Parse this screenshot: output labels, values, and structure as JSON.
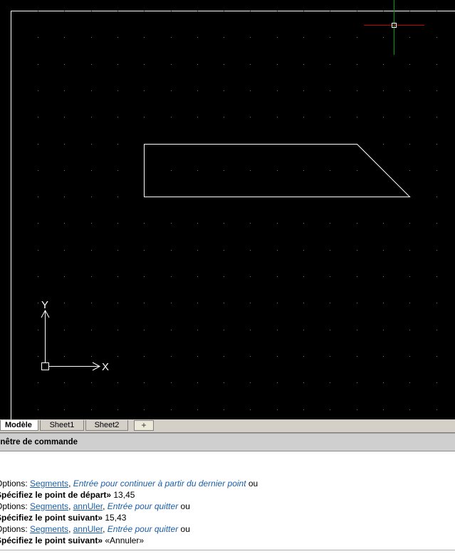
{
  "tabs": [
    {
      "label": "Modèle",
      "active": true
    },
    {
      "label": "Sheet1",
      "active": false
    },
    {
      "label": "Sheet2",
      "active": false
    }
  ],
  "add_tab_label": "+",
  "command_window": {
    "title": "enêtre de commande",
    "lines": [
      {
        "prefix": "Options: ",
        "opt1": "Segments",
        "sep1": ", ",
        "hint": "Entrée pour continuer à partir du dernier point",
        "suffix": " ou"
      },
      {
        "prompt": "Spécifiez le point de départ»",
        "value": " 13,45"
      },
      {
        "prefix": "Options: ",
        "opt1": "Segments",
        "sep1": ", ",
        "opt2a": "ann",
        "opt2b": "Ul",
        "opt2c": "er",
        "sep2": ", ",
        "hint": "Entrée pour quitter",
        "suffix": " ou"
      },
      {
        "prompt": "Spécifiez le point suivant»",
        "value": " 15,43"
      },
      {
        "prefix": "Options: ",
        "opt1": "Segments",
        "sep1": ", ",
        "opt2a": "ann",
        "opt2b": "Ul",
        "opt2c": "er",
        "sep2": ", ",
        "hint": "Entrée pour quitter",
        "suffix": " ou"
      },
      {
        "prompt": "Spécifiez le point suivant»",
        "value": " «Annuler»"
      }
    ]
  },
  "ucs": {
    "x_label": "X",
    "y_label": "Y"
  },
  "colors": {
    "canvas": "#000000",
    "crosshair_x": "#c00000",
    "crosshair_y": "#00a000",
    "option_link": "#1a5ea8"
  }
}
